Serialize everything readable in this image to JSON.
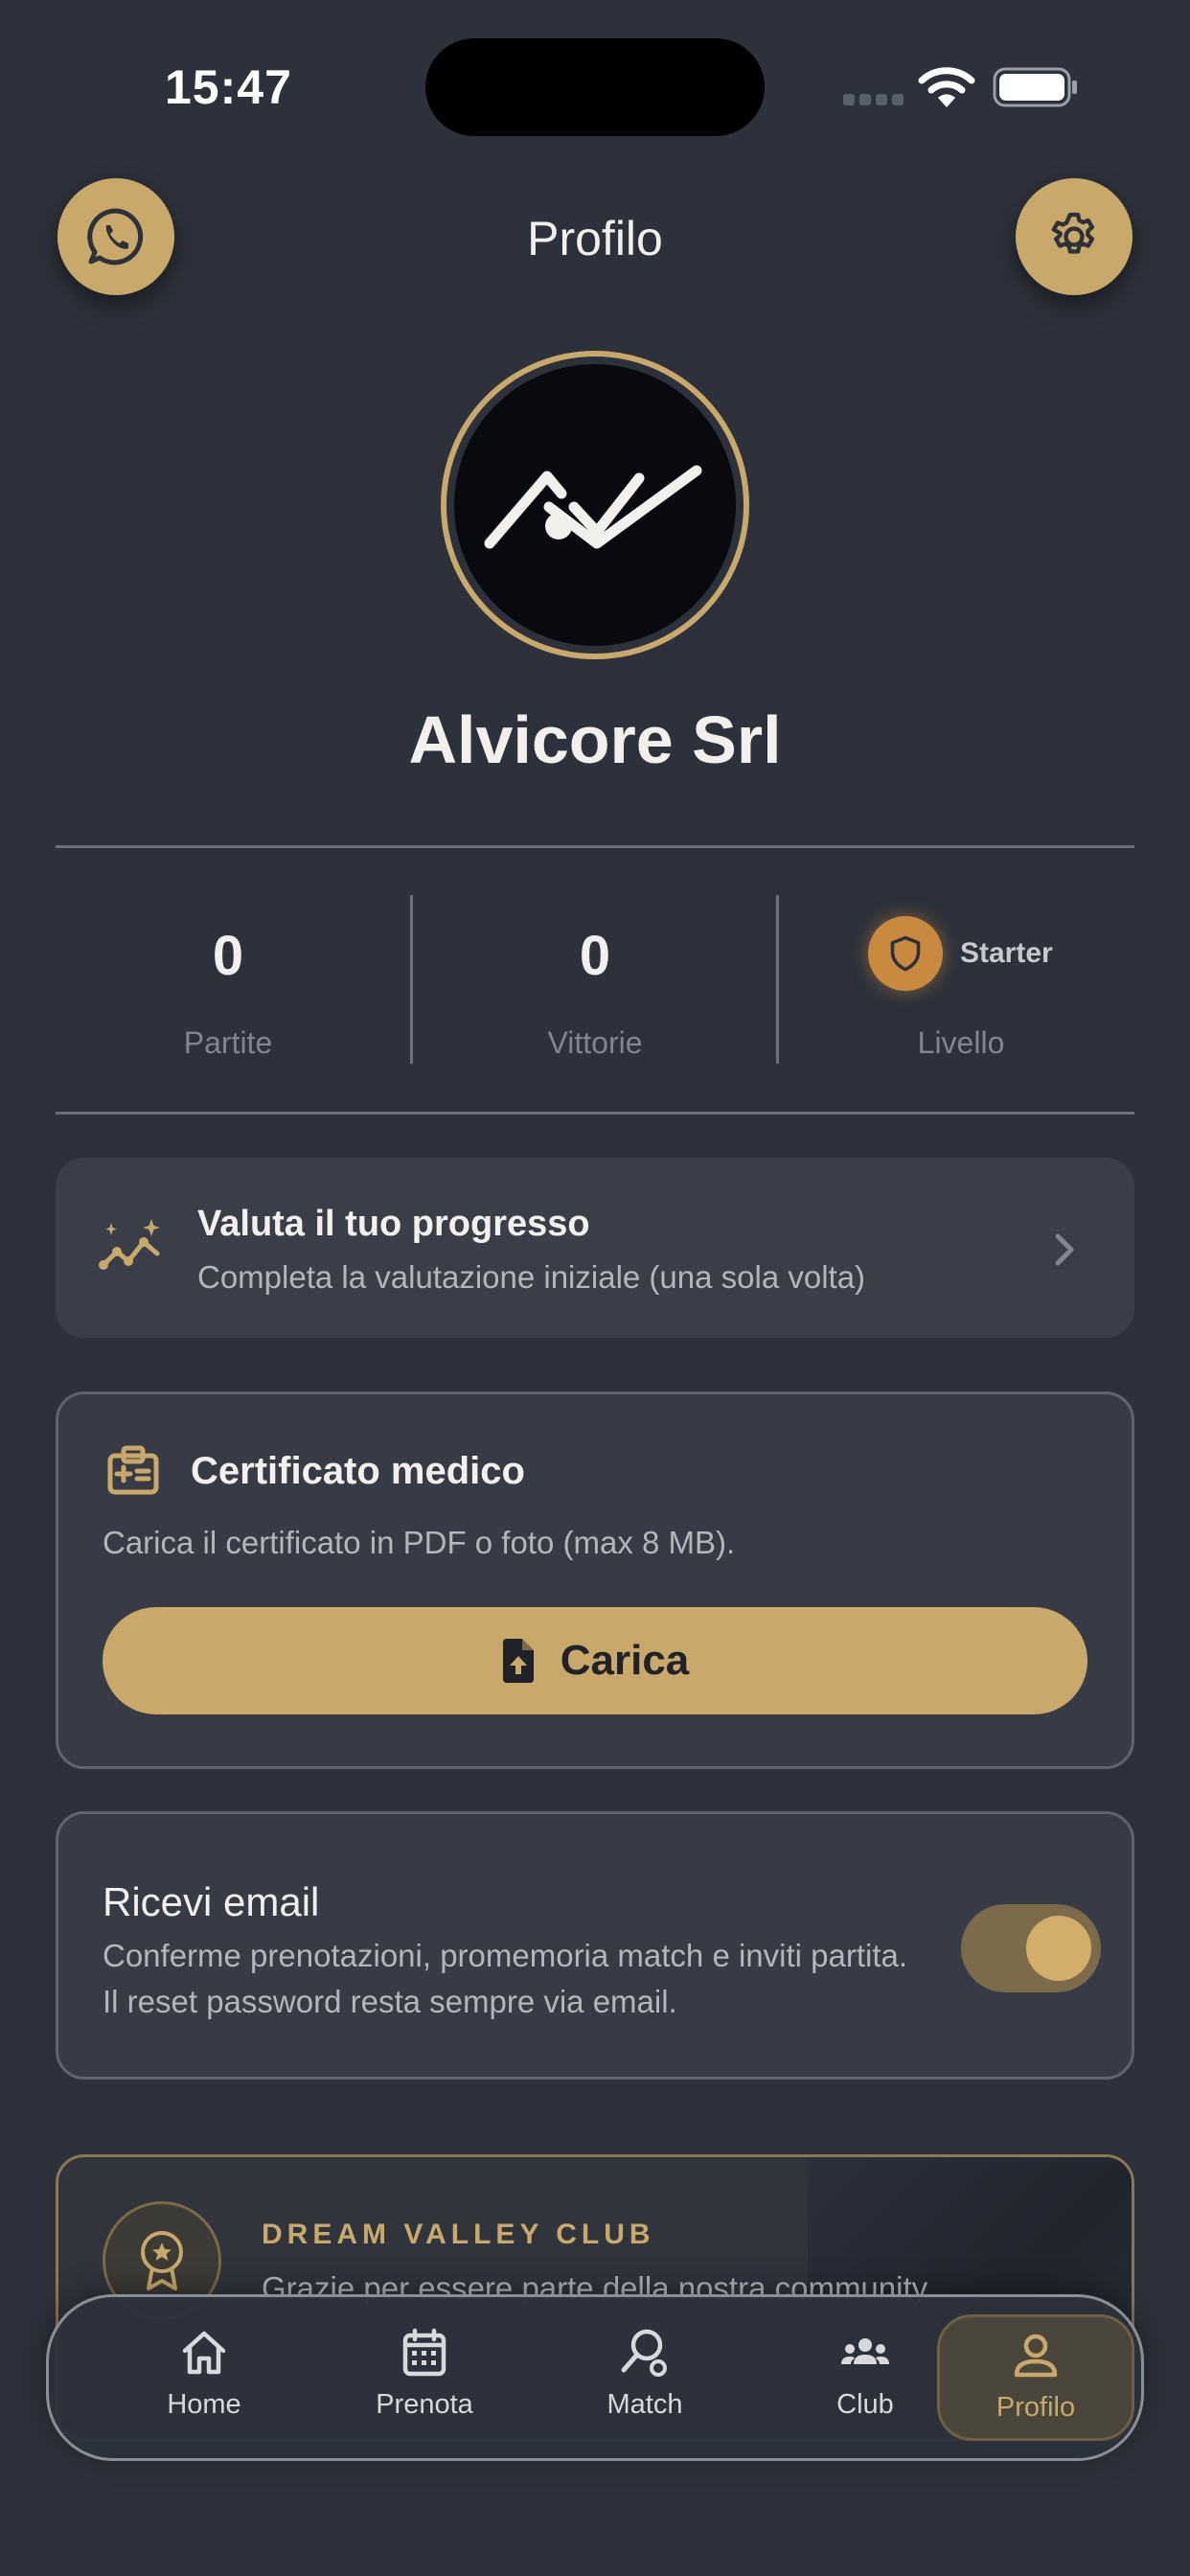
{
  "status_bar": {
    "time": "15:47"
  },
  "header": {
    "title": "Profilo",
    "left_icon": "whatsapp-icon",
    "right_icon": "gear-icon"
  },
  "profile": {
    "name": "Alvicore Srl",
    "avatar_logo": "AV"
  },
  "stats": {
    "matches": {
      "value": "0",
      "label": "Partite"
    },
    "wins": {
      "value": "0",
      "label": "Vittorie"
    },
    "level": {
      "name": "Starter",
      "label": "Livello",
      "icon": "shield-icon"
    }
  },
  "progress_card": {
    "title": "Valuta il tuo progresso",
    "subtitle": "Completa la valutazione iniziale (una sola volta)",
    "icon": "sparkle-chart-icon"
  },
  "certificate_card": {
    "title": "Certificato medico",
    "description": "Carica il certificato in PDF o foto (max 8 MB).",
    "upload_label": "Carica",
    "icon": "medical-id-icon"
  },
  "email_card": {
    "title": "Ricevi email",
    "description": "Conferme prenotazioni, promemoria match e inviti partita. Il reset password resta sempre via email.",
    "toggle_on": true
  },
  "club_card": {
    "name": "DREAM VALLEY CLUB",
    "text": "Grazie per essere parte della nostra community"
  },
  "tabs": [
    {
      "label": "Home",
      "icon": "home-icon",
      "active": false
    },
    {
      "label": "Prenota",
      "icon": "calendar-icon",
      "active": false
    },
    {
      "label": "Match",
      "icon": "racket-icon",
      "active": false
    },
    {
      "label": "Club",
      "icon": "group-icon",
      "active": false
    },
    {
      "label": "Profilo",
      "icon": "user-icon",
      "active": true
    }
  ],
  "colors": {
    "background": "#2c313b",
    "accent_gold": "#c9a96a",
    "card": "#363b46",
    "level_badge": "#c98a3f"
  }
}
